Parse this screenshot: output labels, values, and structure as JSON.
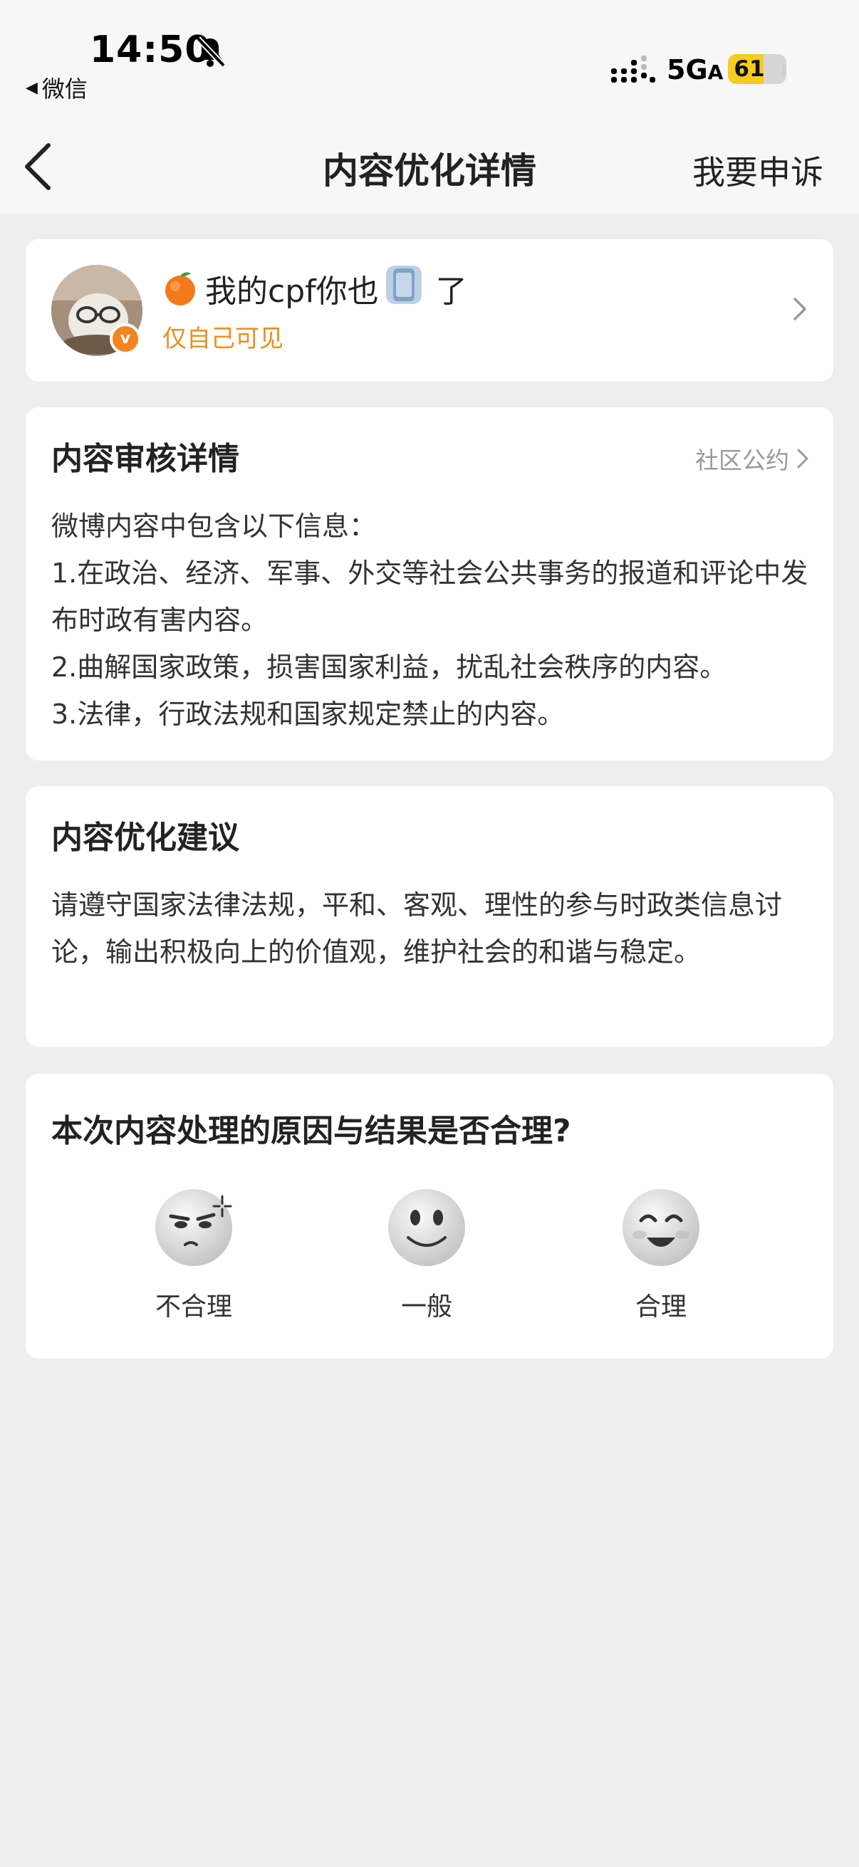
{
  "status_bar": {
    "time": "14:50",
    "back_app": "微信",
    "network": "5G",
    "network_suffix": "A",
    "battery": "61",
    "battery_level_percent": 61
  },
  "nav": {
    "title": "内容优化详情",
    "appeal": "我要申诉"
  },
  "post": {
    "title_prefix": "我的cpf你也",
    "title_suffix": "了",
    "visibility": "仅自己可见"
  },
  "review": {
    "title": "内容审核详情",
    "link": "社区公约",
    "lines": [
      "微博内容中包含以下信息：",
      "1.在政治、经济、军事、外交等社会公共事务的报道和评论中发布时政有害内容。",
      "2.曲解国家政策，损害国家利益，扰乱社会秩序的内容。",
      "3.法律，行政法规和国家规定禁止的内容。"
    ]
  },
  "suggestion": {
    "title": "内容优化建议",
    "text": "请遵守国家法律法规，平和、客观、理性的参与时政类信息讨论，输出积极向上的价值观，维护社会的和谐与稳定。"
  },
  "feedback": {
    "question": "本次内容处理的原因与结果是否合理?",
    "options": [
      {
        "label": "不合理",
        "icon": "angry-face-icon"
      },
      {
        "label": "一般",
        "icon": "neutral-face-icon"
      },
      {
        "label": "合理",
        "icon": "smiling-face-icon"
      }
    ]
  },
  "colors": {
    "accent_orange": "#e8901f",
    "battery_yellow": "#f7cc1e",
    "background": "#eeeeee"
  }
}
